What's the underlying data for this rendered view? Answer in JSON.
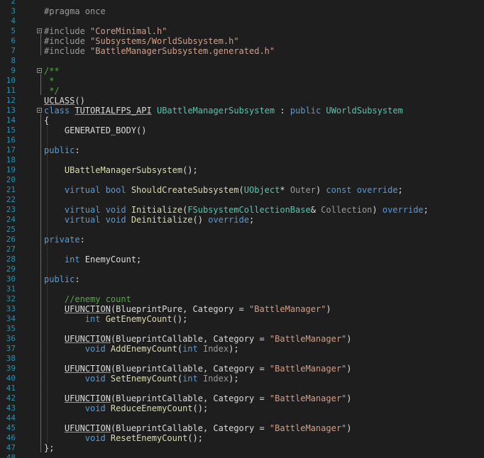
{
  "editor": {
    "language": "cpp",
    "theme": {
      "background": "#1e1e1e",
      "line_number": "#2b91af",
      "keyword": "#569cd6",
      "type": "#4ec9b0",
      "function": "#dcdcaa",
      "string": "#d69d85",
      "comment": "#57a64a"
    },
    "lines": [
      {
        "n": "2",
        "tokens": []
      },
      {
        "n": "3",
        "tokens": [
          {
            "t": "#pragma once",
            "c": "p"
          }
        ]
      },
      {
        "n": "4",
        "tokens": []
      },
      {
        "n": "5",
        "fold": true,
        "tokens": [
          {
            "t": "#include ",
            "c": "p"
          },
          {
            "t": "\"CoreMinimal.h\"",
            "c": "s"
          }
        ]
      },
      {
        "n": "6",
        "tokens": [
          {
            "t": "#include ",
            "c": "p"
          },
          {
            "t": "\"Subsystems/WorldSubsystem.h\"",
            "c": "s"
          }
        ]
      },
      {
        "n": "7",
        "tokens": [
          {
            "t": "#include ",
            "c": "p"
          },
          {
            "t": "\"BattleManagerSubsystem.generated.h\"",
            "c": "s"
          }
        ]
      },
      {
        "n": "8",
        "tokens": []
      },
      {
        "n": "9",
        "fold": true,
        "tokens": [
          {
            "t": "/**",
            "c": "c"
          }
        ]
      },
      {
        "n": "10",
        "tokens": [
          {
            "t": " *",
            "c": "c"
          }
        ]
      },
      {
        "n": "11",
        "tokens": [
          {
            "t": " */",
            "c": "c"
          }
        ]
      },
      {
        "n": "12",
        "tokens": [
          {
            "t": "UCLASS",
            "c": "d",
            "u": true
          },
          {
            "t": "()",
            "c": "d"
          }
        ]
      },
      {
        "n": "13",
        "fold": true,
        "tokens": [
          {
            "t": "class ",
            "c": "k"
          },
          {
            "t": "TUTORIALFPS_API",
            "c": "d",
            "u": true
          },
          {
            "t": " ",
            "c": "d"
          },
          {
            "t": "UBattleManagerSubsystem",
            "c": "t"
          },
          {
            "t": " : ",
            "c": "d"
          },
          {
            "t": "public ",
            "c": "k"
          },
          {
            "t": "UWorldSubsystem",
            "c": "t"
          }
        ]
      },
      {
        "n": "14",
        "tokens": [
          {
            "t": "{",
            "c": "d"
          }
        ]
      },
      {
        "n": "15",
        "tokens": [
          {
            "t": "    GENERATED_BODY",
            "c": "d"
          },
          {
            "t": "()",
            "c": "d"
          }
        ]
      },
      {
        "n": "16",
        "tokens": []
      },
      {
        "n": "17",
        "tokens": [
          {
            "t": "public",
            "c": "k"
          },
          {
            "t": ":",
            "c": "d"
          }
        ]
      },
      {
        "n": "18",
        "tokens": []
      },
      {
        "n": "19",
        "tokens": [
          {
            "t": "    UBattleManagerSubsystem",
            "c": "f"
          },
          {
            "t": "();",
            "c": "d"
          }
        ]
      },
      {
        "n": "20",
        "tokens": []
      },
      {
        "n": "21",
        "tokens": [
          {
            "t": "    virtual ",
            "c": "k"
          },
          {
            "t": "bool ",
            "c": "k"
          },
          {
            "t": "ShouldCreateSubsystem",
            "c": "f"
          },
          {
            "t": "(",
            "c": "d"
          },
          {
            "t": "UObject",
            "c": "t"
          },
          {
            "t": "* ",
            "c": "d"
          },
          {
            "t": "Outer",
            "c": "pa"
          },
          {
            "t": ") ",
            "c": "d"
          },
          {
            "t": "const ",
            "c": "k"
          },
          {
            "t": "override",
            "c": "k"
          },
          {
            "t": ";",
            "c": "d"
          }
        ]
      },
      {
        "n": "22",
        "tokens": []
      },
      {
        "n": "23",
        "tokens": [
          {
            "t": "    virtual ",
            "c": "k"
          },
          {
            "t": "void ",
            "c": "k"
          },
          {
            "t": "Initialize",
            "c": "f"
          },
          {
            "t": "(",
            "c": "d"
          },
          {
            "t": "FSubsystemCollectionBase",
            "c": "t"
          },
          {
            "t": "& ",
            "c": "d"
          },
          {
            "t": "Collection",
            "c": "pa"
          },
          {
            "t": ") ",
            "c": "d"
          },
          {
            "t": "override",
            "c": "k"
          },
          {
            "t": ";",
            "c": "d"
          }
        ]
      },
      {
        "n": "24",
        "tokens": [
          {
            "t": "    virtual ",
            "c": "k"
          },
          {
            "t": "void ",
            "c": "k"
          },
          {
            "t": "Deinitialize",
            "c": "f"
          },
          {
            "t": "() ",
            "c": "d"
          },
          {
            "t": "override",
            "c": "k"
          },
          {
            "t": ";",
            "c": "d"
          }
        ]
      },
      {
        "n": "25",
        "tokens": []
      },
      {
        "n": "26",
        "tokens": [
          {
            "t": "private",
            "c": "k"
          },
          {
            "t": ":",
            "c": "d"
          }
        ]
      },
      {
        "n": "27",
        "tokens": []
      },
      {
        "n": "28",
        "tokens": [
          {
            "t": "    int ",
            "c": "k"
          },
          {
            "t": "EnemyCount",
            "c": "d"
          },
          {
            "t": ";",
            "c": "d"
          }
        ]
      },
      {
        "n": "29",
        "tokens": []
      },
      {
        "n": "30",
        "tokens": [
          {
            "t": "public",
            "c": "k"
          },
          {
            "t": ":",
            "c": "d"
          }
        ]
      },
      {
        "n": "31",
        "tokens": []
      },
      {
        "n": "32",
        "tokens": [
          {
            "t": "    //enemy count",
            "c": "c"
          }
        ]
      },
      {
        "n": "33",
        "tokens": [
          {
            "t": "    ",
            "c": "d"
          },
          {
            "t": "UFUNCTION",
            "c": "d",
            "u": true
          },
          {
            "t": "(BlueprintPure, Category = ",
            "c": "d"
          },
          {
            "t": "\"BattleManager\"",
            "c": "s"
          },
          {
            "t": ")",
            "c": "d"
          }
        ]
      },
      {
        "n": "34",
        "tokens": [
          {
            "t": "        int ",
            "c": "k"
          },
          {
            "t": "GetEnemyCount",
            "c": "f"
          },
          {
            "t": "();",
            "c": "d"
          }
        ]
      },
      {
        "n": "35",
        "tokens": []
      },
      {
        "n": "36",
        "tokens": [
          {
            "t": "    ",
            "c": "d"
          },
          {
            "t": "UFUNCTION",
            "c": "d",
            "u": true
          },
          {
            "t": "(BlueprintCallable, Category = ",
            "c": "d"
          },
          {
            "t": "\"BattleManager\"",
            "c": "s"
          },
          {
            "t": ")",
            "c": "d"
          }
        ]
      },
      {
        "n": "37",
        "tokens": [
          {
            "t": "        void ",
            "c": "k"
          },
          {
            "t": "AddEnemyCount",
            "c": "f"
          },
          {
            "t": "(",
            "c": "d"
          },
          {
            "t": "int ",
            "c": "k"
          },
          {
            "t": "Index",
            "c": "pa"
          },
          {
            "t": ");",
            "c": "d"
          }
        ]
      },
      {
        "n": "38",
        "tokens": []
      },
      {
        "n": "39",
        "tokens": [
          {
            "t": "    ",
            "c": "d"
          },
          {
            "t": "UFUNCTION",
            "c": "d",
            "u": true
          },
          {
            "t": "(BlueprintCallable, Category = ",
            "c": "d"
          },
          {
            "t": "\"BattleManager\"",
            "c": "s"
          },
          {
            "t": ")",
            "c": "d"
          }
        ]
      },
      {
        "n": "40",
        "tokens": [
          {
            "t": "        void ",
            "c": "k"
          },
          {
            "t": "SetEnemyCount",
            "c": "f"
          },
          {
            "t": "(",
            "c": "d"
          },
          {
            "t": "int ",
            "c": "k"
          },
          {
            "t": "Index",
            "c": "pa"
          },
          {
            "t": ");",
            "c": "d"
          }
        ]
      },
      {
        "n": "41",
        "tokens": []
      },
      {
        "n": "42",
        "tokens": [
          {
            "t": "    ",
            "c": "d"
          },
          {
            "t": "UFUNCTION",
            "c": "d",
            "u": true
          },
          {
            "t": "(BlueprintCallable, Category = ",
            "c": "d"
          },
          {
            "t": "\"BattleManager\"",
            "c": "s"
          },
          {
            "t": ")",
            "c": "d"
          }
        ]
      },
      {
        "n": "43",
        "tokens": [
          {
            "t": "        void ",
            "c": "k"
          },
          {
            "t": "ReduceEnemyCount",
            "c": "f"
          },
          {
            "t": "();",
            "c": "d"
          }
        ]
      },
      {
        "n": "44",
        "tokens": []
      },
      {
        "n": "45",
        "tokens": [
          {
            "t": "    ",
            "c": "d"
          },
          {
            "t": "UFUNCTION",
            "c": "d",
            "u": true
          },
          {
            "t": "(BlueprintCallable, Category = ",
            "c": "d"
          },
          {
            "t": "\"BattleManager\"",
            "c": "s"
          },
          {
            "t": ")",
            "c": "d"
          }
        ]
      },
      {
        "n": "46",
        "tokens": [
          {
            "t": "        void ",
            "c": "k"
          },
          {
            "t": "ResetEnemyCount",
            "c": "f"
          },
          {
            "t": "();",
            "c": "d"
          }
        ]
      },
      {
        "n": "47",
        "tokens": [
          {
            "t": "};",
            "c": "d"
          }
        ]
      },
      {
        "n": "48",
        "tokens": []
      }
    ]
  }
}
